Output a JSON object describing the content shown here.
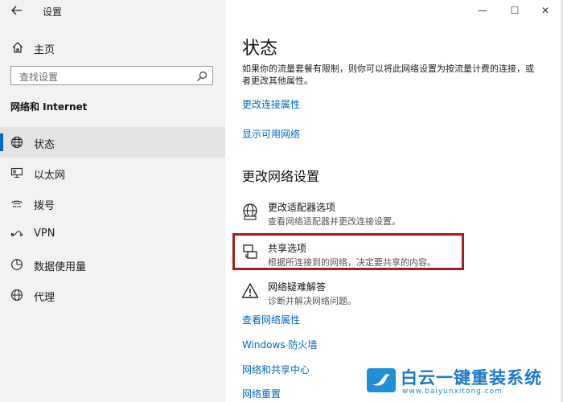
{
  "window": {
    "title": "设置",
    "controls": [
      "—",
      "☐",
      "✕"
    ]
  },
  "left": {
    "home_label": "主页",
    "search_placeholder": "查找设置",
    "section_title": "网络和 Internet",
    "items": [
      {
        "label": "状态",
        "icon": "globe-status-icon",
        "selected": true
      },
      {
        "label": "以太网",
        "icon": "ethernet-icon"
      },
      {
        "label": "拨号",
        "icon": "dialup-icon"
      },
      {
        "label": "VPN",
        "icon": "vpn-icon"
      },
      {
        "label": "数据使用量",
        "icon": "data-usage-icon"
      },
      {
        "label": "代理",
        "icon": "proxy-globe-icon"
      }
    ]
  },
  "main": {
    "title": "状态",
    "description": "如果你的流量套餐有限制，则你可以将此网络设置为按流量计费的连接，或者更改其他属性。",
    "link_change_props": "更改连接属性",
    "link_show_networks": "显示可用网络",
    "section2_title": "更改网络设置",
    "options": [
      {
        "title": "更改适配器选项",
        "subtitle": "查看网络适配器并更改连接设置。",
        "icon": "adapter-icon"
      },
      {
        "title": "共享选项",
        "subtitle": "根据所连接到的网络，决定要共享的内容。",
        "icon": "sharing-icon"
      },
      {
        "title": "网络疑难解答",
        "subtitle": "诊断并解决网络问题。",
        "icon": "warning-icon"
      }
    ],
    "bottom_links": [
      "查看网络属性",
      "Windows 防火墙",
      "网络和共享中心",
      "网络重置"
    ]
  },
  "watermark": {
    "title": "白云一键重装系统",
    "url": "www.baiyunxitong.com"
  },
  "colors": {
    "accent": "#0067c0",
    "highlight": "#a21f1f",
    "sidebar_bg": "#f2f2f2"
  }
}
